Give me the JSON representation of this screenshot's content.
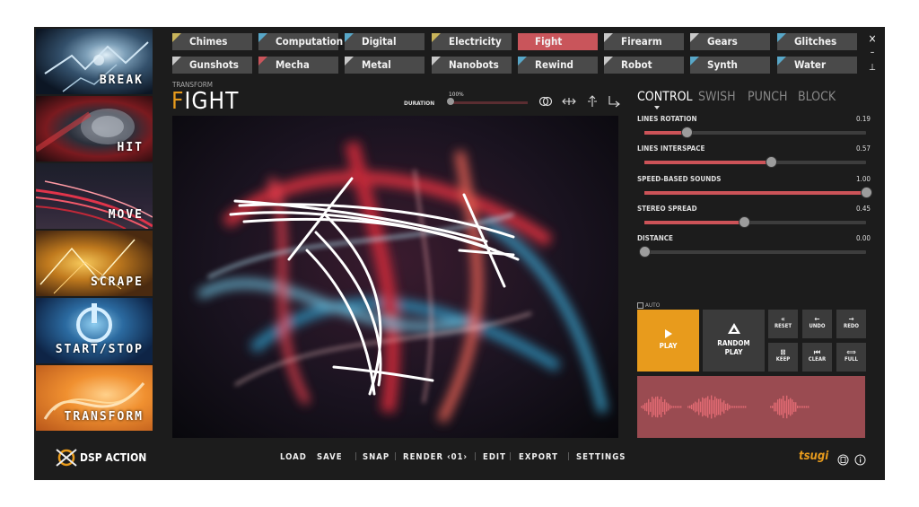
{
  "categories": [
    {
      "label": "BREAK"
    },
    {
      "label": "HIT"
    },
    {
      "label": "MOVE"
    },
    {
      "label": "SCRAPE"
    },
    {
      "label": "START/STOP"
    },
    {
      "label": "TRANSFORM"
    }
  ],
  "presets": [
    {
      "label": "Chimes",
      "color": "#c9b45a"
    },
    {
      "label": "Computation",
      "color": "#58a7c8"
    },
    {
      "label": "Digital",
      "color": "#58a7c8"
    },
    {
      "label": "Electricity",
      "color": "#c9b45a"
    },
    {
      "label": "Fight",
      "color": "#c9555b",
      "selected": true
    },
    {
      "label": "Firearm",
      "color": "#c9c9c9"
    },
    {
      "label": "Gears",
      "color": "#c9c9c9"
    },
    {
      "label": "Glitches",
      "color": "#58a7c8"
    },
    {
      "label": "Gunshots",
      "color": "#c9c9c9"
    },
    {
      "label": "Mecha",
      "color": "#c9555b"
    },
    {
      "label": "Metal",
      "color": "#c9c9c9"
    },
    {
      "label": "Nanobots",
      "color": "#c9c9c9"
    },
    {
      "label": "Rewind",
      "color": "#58a7c8"
    },
    {
      "label": "Robot",
      "color": "#c9c9c9"
    },
    {
      "label": "Synth",
      "color": "#58a7c8"
    },
    {
      "label": "Water",
      "color": "#58a7c8"
    }
  ],
  "window": {
    "close": "×",
    "minimize": "–",
    "pin": "⊥"
  },
  "header": {
    "category": "TRANSFORM",
    "title_first": "F",
    "title_rest": "IGHT",
    "duration_label": "DURATION",
    "duration_value": "100%"
  },
  "tabs": [
    {
      "label": "CONTROL"
    },
    {
      "label": "SWISH"
    },
    {
      "label": "PUNCH"
    },
    {
      "label": "BLOCK"
    }
  ],
  "sliders": [
    {
      "label": "LINES ROTATION",
      "value": "0.19",
      "fraction": 0.19
    },
    {
      "label": "LINES INTERSPACE",
      "value": "0.57",
      "fraction": 0.57
    },
    {
      "label": "SPEED-BASED SOUNDS",
      "value": "1.00",
      "fraction": 1.0
    },
    {
      "label": "STEREO SPREAD",
      "value": "0.45",
      "fraction": 0.45
    },
    {
      "label": "DISTANCE",
      "value": "0.00",
      "fraction": 0.0
    }
  ],
  "duration_fraction": 0.0,
  "auto_label": "AUTO",
  "play_label": "PLAY",
  "random_label": "RANDOM PLAY",
  "controls": [
    {
      "label": "RESET",
      "icon": "«"
    },
    {
      "label": "UNDO",
      "icon": "←"
    },
    {
      "label": "REDO",
      "icon": "→"
    },
    {
      "label": "KEEP",
      "icon": "⊠"
    },
    {
      "label": "CLEAR",
      "icon": "⏮"
    },
    {
      "label": "FULL",
      "icon": "⟺"
    }
  ],
  "footer": {
    "app_name": "DSP ACTION",
    "menu": [
      "LOAD",
      "SAVE",
      "SNAP",
      "RENDER ‹01›",
      "EDIT",
      "EXPORT",
      "SETTINGS"
    ],
    "brand": "tsugi"
  },
  "colors": {
    "accent": "#e89b1c",
    "preset_selected": "#c9555b",
    "slider_fill": "#cc5358"
  }
}
